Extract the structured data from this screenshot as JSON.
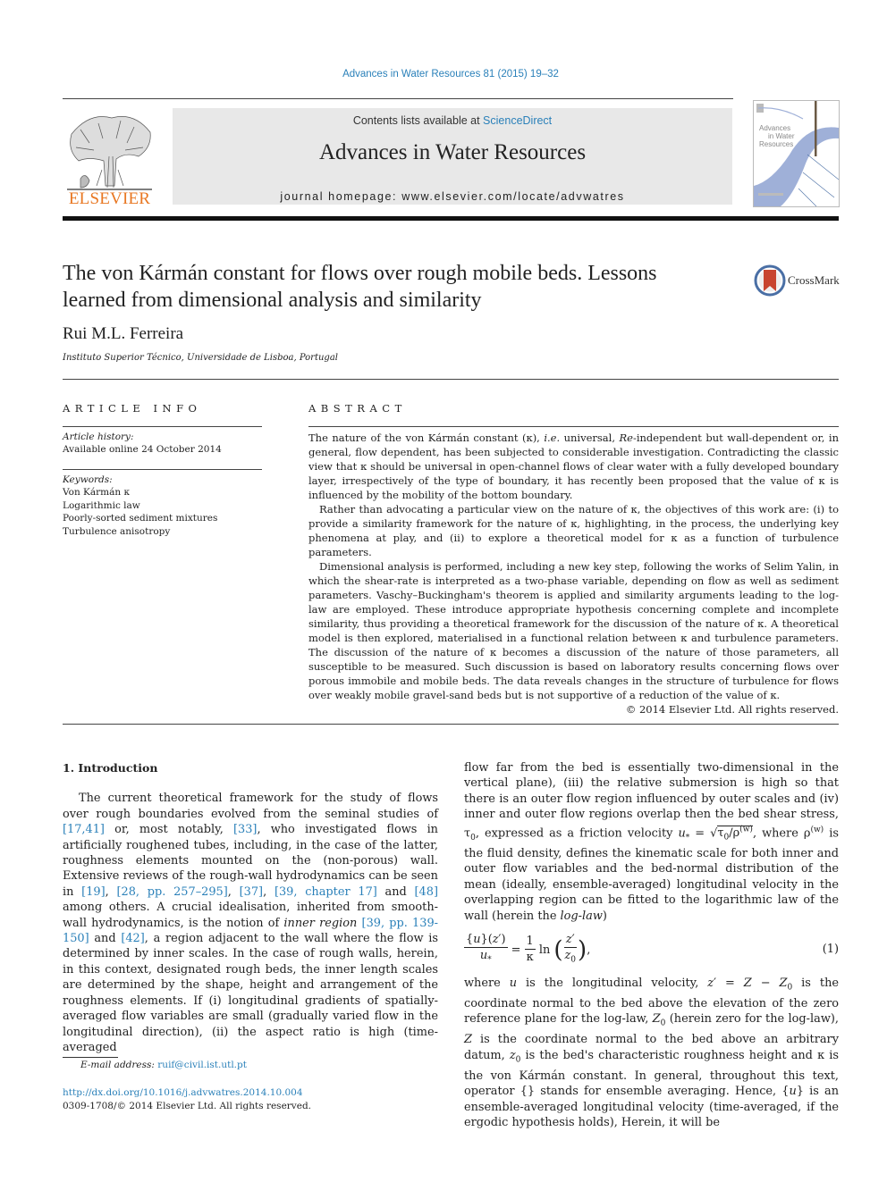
{
  "header": {
    "citation": "Advances in Water Resources 81 (2015) 19–32",
    "contents_prefix": "Contents lists available at ",
    "contents_link": "ScienceDirect",
    "journal_title": "Advances in Water Resources",
    "homepage_prefix": "journal homepage: ",
    "homepage_url": "www.elsevier.com/locate/advwatres",
    "publisher_logo_text": "ELSEVIER",
    "cover_title_lines": [
      "Advances",
      "in Water",
      "Resources"
    ],
    "colors": {
      "link": "#2a80b9",
      "elsevier_orange": "#e87722",
      "banner_bg": "#e8e8e8",
      "cover_wave": "#9fb0d8"
    }
  },
  "article": {
    "title": "The von Kármán constant for flows over rough mobile beds. Lessons learned from dimensional analysis and similarity",
    "crossmark_label": "CrossMark",
    "author": "Rui M.L. Ferreira",
    "affiliation": "Instituto Superior Técnico, Universidade de Lisboa, Portugal"
  },
  "article_info": {
    "heading": "ARTICLE INFO",
    "history_label": "Article history:",
    "history_value": "Available online 24 October 2014",
    "keywords_label": "Keywords:",
    "keywords": [
      "Von Kármán κ",
      "Logarithmic law",
      "Poorly-sorted sediment mixtures",
      "Turbulence anisotropy"
    ]
  },
  "abstract": {
    "heading": "ABSTRACT",
    "p1_a": "The nature of the von Kármán constant (κ), ",
    "p1_ie": "i.e.",
    "p1_b": " universal, ",
    "p1_re": "Re",
    "p1_c": "-independent but wall-dependent or, in general, flow dependent, has been subjected to considerable investigation. Contradicting the classic view that κ should be universal in open-channel flows of clear water with a fully developed boundary layer, irrespectively of the type of boundary, it has recently been proposed that the value of κ is influenced by the mobility of the bottom boundary.",
    "p2": "Rather than advocating a particular view on the nature of κ, the objectives of this work are: (i) to provide a similarity framework for the nature of κ, highlighting, in the process, the underlying key phenomena at play, and (ii) to explore a theoretical model for κ as a function of turbulence parameters.",
    "p3": "Dimensional analysis is performed, including a new key step, following the works of Selim Yalin, in which the shear-rate is interpreted as a two-phase variable, depending on flow as well as sediment parameters. Vaschy–Buckingham's theorem is applied and similarity arguments leading to the log-law are employed. These introduce appropriate hypothesis concerning complete and incomplete similarity, thus providing a theoretical framework for the discussion of the nature of κ. A theoretical model is then explored, materialised in a functional relation between κ and turbulence parameters. The discussion of the nature of κ becomes a discussion of the nature of those parameters, all susceptible to be measured. Such discussion is based on laboratory results concerning flows over porous immobile and mobile beds. The data reveals changes in the structure of turbulence for flows over weakly mobile gravel-sand beds but is not supportive of a reduction of the value of κ.",
    "copyright": "© 2014 Elsevier Ltd. All rights reserved."
  },
  "body": {
    "section_heading": "1. Introduction",
    "col1": {
      "t1": "The current theoretical framework for the study of flows over rough boundaries evolved from the seminal studies of ",
      "r1": "[17,41]",
      "t2": " or, most notably, ",
      "r2": "[33]",
      "t3": ", who investigated flows in artificially roughened tubes, including, in the case of the latter, roughness elements mounted on the (non-porous) wall. Extensive reviews of the rough-wall hydrodynamics can be seen in ",
      "r3": "[19]",
      "t4": ", ",
      "r4": "[28, pp. 257–295]",
      "t5": ", ",
      "r5": "[37]",
      "t6": ", ",
      "r6": "[39, chapter 17]",
      "t7": " and ",
      "r7": "[48]",
      "t8": " among others. A crucial idealisation, inherited from smooth-wall hydrodynamics, is the notion of ",
      "inner_region": "inner region",
      "t9": " ",
      "r8": "[39, pp. 139-150]",
      "t10": " and ",
      "r9": "[42]",
      "t11": ", a region adjacent to the wall where the flow is determined by inner scales. In the case of rough walls, herein, in this context, designated rough beds, the inner length scales are determined by the shape, height and arrangement of the roughness elements. If (i) longitudinal gradients of spatially-averaged flow variables are small (gradually varied flow in the longitudinal direction), (ii) the aspect ratio is high (time-averaged"
    },
    "col2": {
      "a1": "flow far from the bed is essentially two-dimensional in the vertical plane), (iii) the relative submersion is high so that there is an outer flow region influenced by outer scales and (iv) inner and outer flow regions overlap then the bed shear stress, τ",
      "a2": ", expressed as a friction velocity ",
      "a3": ", where ρ",
      "a4": " is the fluid density, defines the kinematic scale for both inner and outer flow variables and the bed-normal distribution of the mean (ideally, ensemble-averaged) longitudinal velocity in the overlapping region can be fitted to the logarithmic law of the wall (herein the ",
      "loglaw": "log-law",
      "a5": ")",
      "eq_number": "(1)",
      "b1": "where ",
      "b2": " is the longitudinal velocity, ",
      "b3": " is the coordinate normal to the bed above the elevation of the zero reference plane for the log-law, ",
      "b4": " (herein zero for the log-law), ",
      "b5": " is the coordinate normal to the bed above an arbitrary datum, ",
      "b6": " is the bed's characteristic roughness height and κ is the von Kármán constant. In general, throughout this text, operator {} stands for ensemble averaging. Hence, {",
      "b7": "} is an ensemble-averaged longitudinal velocity (time-averaged, if the ergodic hypothesis holds), Herein, it will be"
    }
  },
  "footer": {
    "email_label": "E-mail address: ",
    "email": "ruif@civil.ist.utl.pt",
    "doi_url": "http://dx.doi.org/10.1016/j.advwatres.2014.10.004",
    "issn_copyright": "0309-1708/© 2014 Elsevier Ltd. All rights reserved."
  }
}
